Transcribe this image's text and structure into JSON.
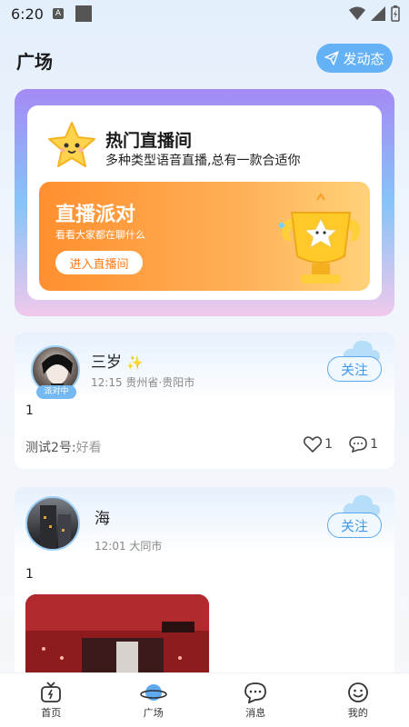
{
  "status_bar": {
    "time": "6:20",
    "a_icon": "A"
  },
  "header": {
    "title": "广场",
    "post_button": "发动态"
  },
  "live_banner": {
    "title": "热门直播间",
    "subtitle": "多种类型语音直播,总有一款合适你",
    "party": {
      "title": "直播派对",
      "subtitle": "看看大家都在聊什么",
      "enter_button": "进入直播间"
    }
  },
  "posts": [
    {
      "username": "三岁",
      "badge": "派对中",
      "time": "12:15",
      "location": "贵州省·贵阳市",
      "follow": "关注",
      "text": "1",
      "comment_user": "测试2号:",
      "comment_text": "好看",
      "likes": "1",
      "comments": "1"
    },
    {
      "username": "海",
      "time": "12:01",
      "location": "大同市",
      "follow": "关注",
      "text": "1"
    }
  ],
  "nav": [
    {
      "label": "首页",
      "icon": "tv-icon"
    },
    {
      "label": "广场",
      "icon": "planet-icon"
    },
    {
      "label": "消息",
      "icon": "chat-icon"
    },
    {
      "label": "我的",
      "icon": "smile-icon"
    }
  ],
  "colors": {
    "accent": "#64b2f5",
    "orange": "#ff8f2e",
    "follow": "#3f98e8"
  }
}
